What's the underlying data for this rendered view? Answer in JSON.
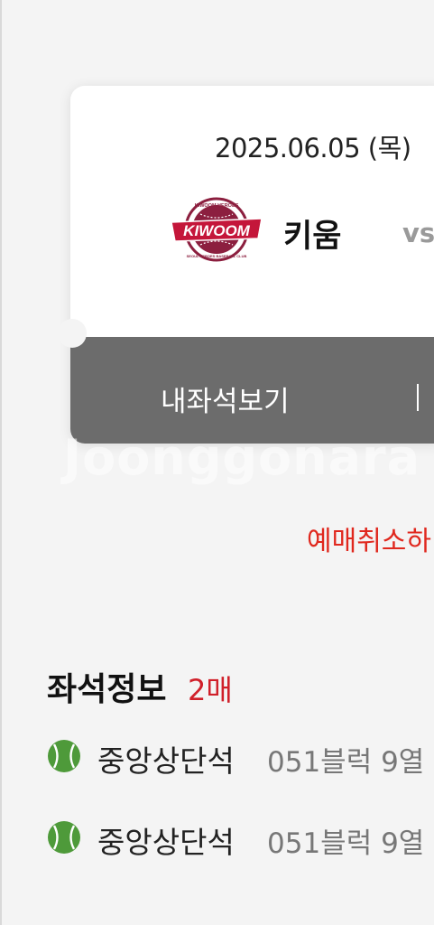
{
  "ticket": {
    "date": "2025.06.05 (목)",
    "home_team": "키움",
    "vs": "vs",
    "logo_text_top": "KIWOOM HEROES",
    "logo_text_main": "KIWOOM",
    "logo_text_bottom": "SEOUL HEROES BASEBALL CLUB",
    "seat_view_label": "내좌석보기",
    "divider": "|"
  },
  "watermark": "Joonggonara",
  "cancel_link": "예매취소하",
  "seat_info": {
    "heading": "좌석정보",
    "count": "2매",
    "seats": [
      {
        "section": "중앙상단석",
        "detail": "051블럭 9열"
      },
      {
        "section": "중앙상단석",
        "detail": "051블럭 9열"
      }
    ]
  },
  "colors": {
    "accent_red": "#e0281e",
    "count_red": "#d0202a",
    "ticket_bottom": "#6c6c6c",
    "ball_green": "#4e9a3a",
    "logo_maroon": "#8c1f3f"
  },
  "icons": {
    "seat_icon": "baseball-icon",
    "team_logo": "kiwoom-heroes-logo"
  }
}
